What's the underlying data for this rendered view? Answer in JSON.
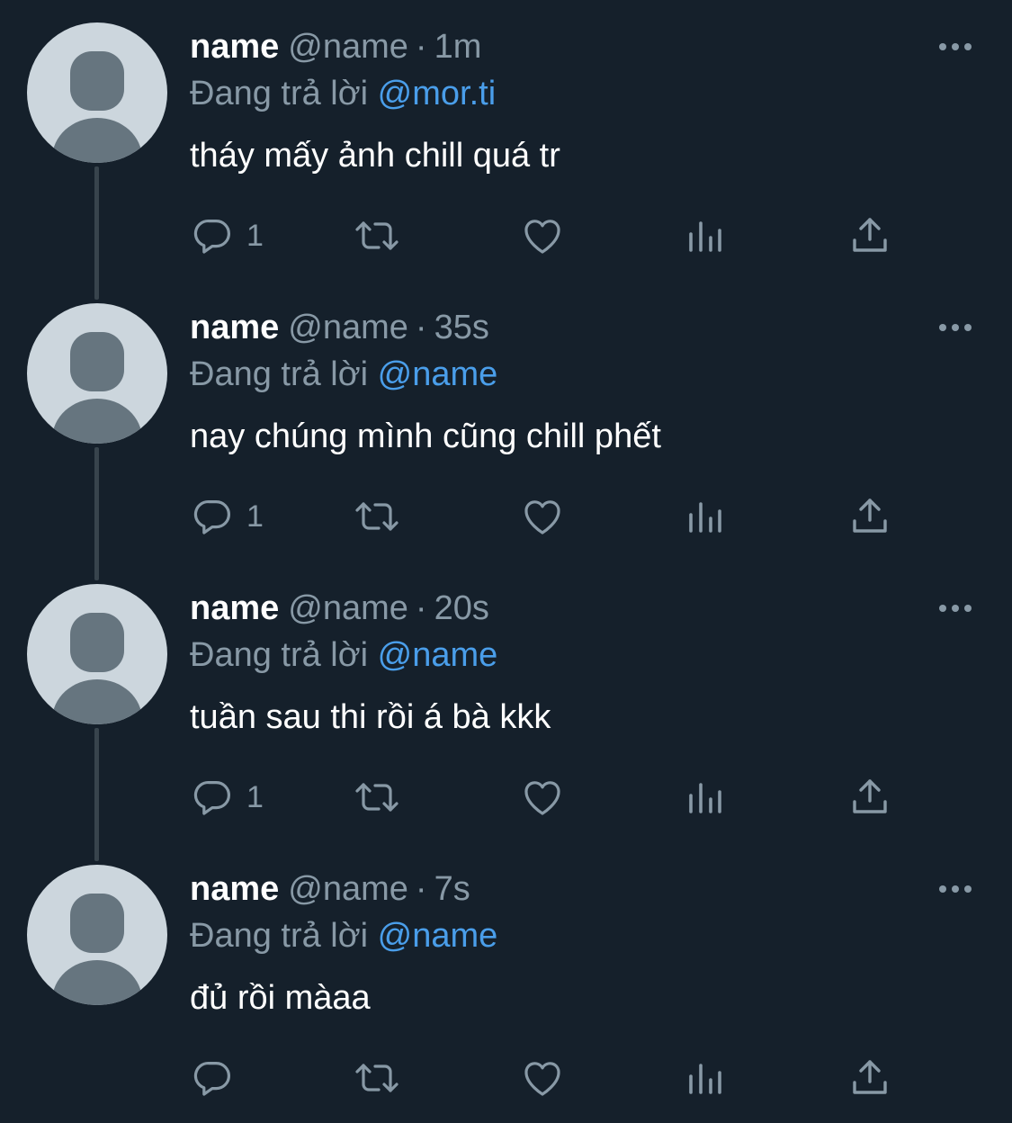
{
  "colors": {
    "background": "#15202b",
    "primary_text": "#ffffff",
    "secondary_text": "#8899a6",
    "link": "#4a9eea",
    "avatar_bg": "#ccd6dd",
    "avatar_fg": "#66757f",
    "thread_line": "#38444d"
  },
  "tweets": [
    {
      "display_name": "name",
      "handle": "@name",
      "separator": "·",
      "time": "1m",
      "reply_prefix": "Đang trả lời",
      "reply_to": "@mor.ti",
      "text": "tháy mấy ảnh chill quá tr",
      "reply_count": "1",
      "icons": [
        "reply-icon",
        "retweet-icon",
        "like-icon",
        "views-icon",
        "share-icon",
        "more-icon"
      ]
    },
    {
      "display_name": "name",
      "handle": "@name",
      "separator": "·",
      "time": "35s",
      "reply_prefix": "Đang trả lời",
      "reply_to": "@name",
      "text": "nay chúng mình cũng chill phết",
      "reply_count": "1",
      "icons": [
        "reply-icon",
        "retweet-icon",
        "like-icon",
        "views-icon",
        "share-icon",
        "more-icon"
      ]
    },
    {
      "display_name": "name",
      "handle": "@name",
      "separator": "·",
      "time": "20s",
      "reply_prefix": "Đang trả lời",
      "reply_to": "@name",
      "text": "tuần sau thi rồi á bà kkk",
      "reply_count": "1",
      "icons": [
        "reply-icon",
        "retweet-icon",
        "like-icon",
        "views-icon",
        "share-icon",
        "more-icon"
      ]
    },
    {
      "display_name": "name",
      "handle": "@name",
      "separator": "·",
      "time": "7s",
      "reply_prefix": "Đang trả lời",
      "reply_to": "@name",
      "text": "đủ rồi màaa",
      "reply_count": "",
      "icons": [
        "reply-icon",
        "retweet-icon",
        "like-icon",
        "views-icon",
        "share-icon",
        "more-icon"
      ]
    }
  ]
}
